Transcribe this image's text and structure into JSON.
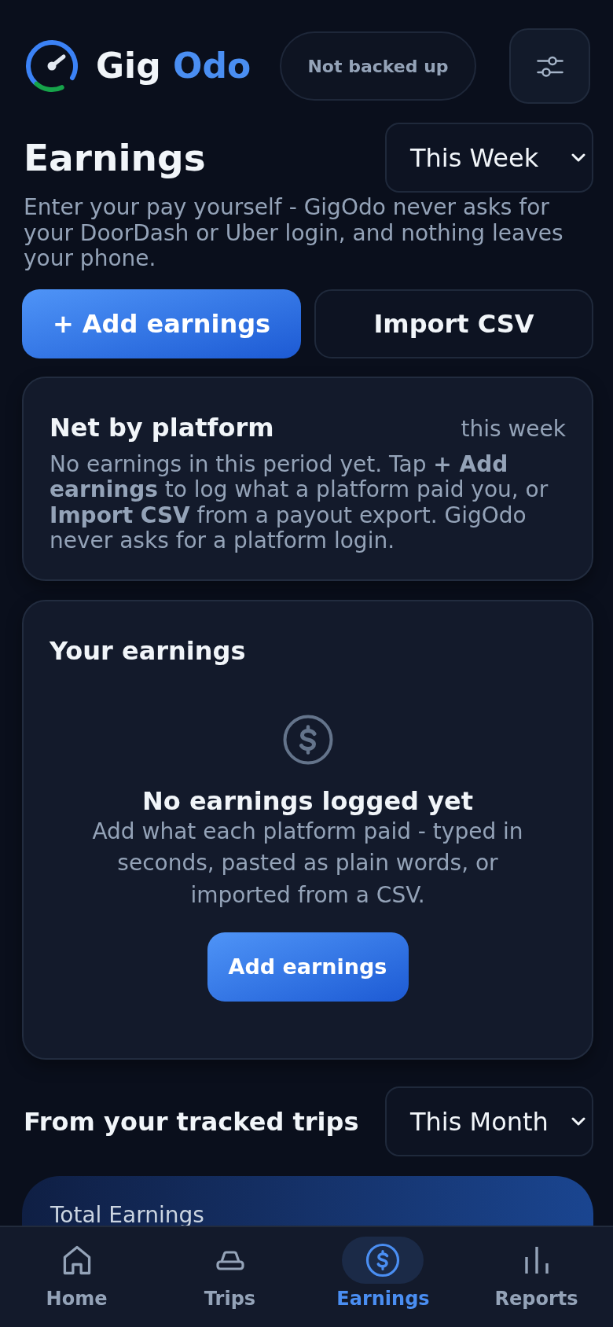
{
  "header": {
    "app_name": {
      "first": "Gig",
      "second": "Odo"
    },
    "backup_status": "Not backed up"
  },
  "page": {
    "title": "Earnings",
    "period": "This Week",
    "description": "Enter your pay yourself - GigOdo never asks for your DoorDash or Uber login, and nothing leaves your phone.",
    "actions": [
      {
        "label": "+ Add earnings",
        "kind": "primary"
      },
      {
        "label": "Import CSV",
        "kind": "secondary"
      }
    ]
  },
  "net_by_platform": {
    "title": "Net by platform",
    "period": "this week",
    "message": "No earnings in this period yet. Tap **+ Add earnings** to log what a platform paid you, or **Import CSV** from a payout export. GigOdo never asks for a platform login."
  },
  "your_earnings": {
    "title": "Your earnings",
    "empty_state": {
      "title": "No earnings logged yet",
      "message": "Add what each platform paid - typed in seconds, pasted as plain words, or imported from a CSV.",
      "button": "Add earnings"
    }
  },
  "tracked_trips": {
    "title": "From your tracked trips",
    "period": "This Month",
    "summary_card": {
      "label": "Total Earnings"
    }
  },
  "nav": [
    {
      "label": "Home",
      "selected": false
    },
    {
      "label": "Trips",
      "selected": false
    },
    {
      "label": "Earnings",
      "selected": true
    },
    {
      "label": "Reports",
      "selected": false
    }
  ]
}
